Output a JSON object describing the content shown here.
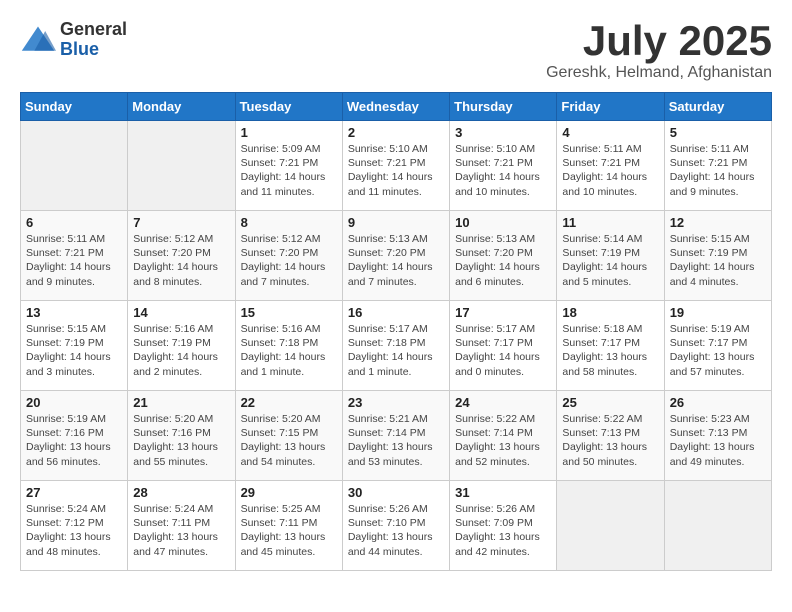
{
  "logo": {
    "general": "General",
    "blue": "Blue"
  },
  "title": "July 2025",
  "subtitle": "Gereshk, Helmand, Afghanistan",
  "days_header": [
    "Sunday",
    "Monday",
    "Tuesday",
    "Wednesday",
    "Thursday",
    "Friday",
    "Saturday"
  ],
  "weeks": [
    [
      {
        "day": "",
        "info": ""
      },
      {
        "day": "",
        "info": ""
      },
      {
        "day": "1",
        "info": "Sunrise: 5:09 AM\nSunset: 7:21 PM\nDaylight: 14 hours\nand 11 minutes."
      },
      {
        "day": "2",
        "info": "Sunrise: 5:10 AM\nSunset: 7:21 PM\nDaylight: 14 hours\nand 11 minutes."
      },
      {
        "day": "3",
        "info": "Sunrise: 5:10 AM\nSunset: 7:21 PM\nDaylight: 14 hours\nand 10 minutes."
      },
      {
        "day": "4",
        "info": "Sunrise: 5:11 AM\nSunset: 7:21 PM\nDaylight: 14 hours\nand 10 minutes."
      },
      {
        "day": "5",
        "info": "Sunrise: 5:11 AM\nSunset: 7:21 PM\nDaylight: 14 hours\nand 9 minutes."
      }
    ],
    [
      {
        "day": "6",
        "info": "Sunrise: 5:11 AM\nSunset: 7:21 PM\nDaylight: 14 hours\nand 9 minutes."
      },
      {
        "day": "7",
        "info": "Sunrise: 5:12 AM\nSunset: 7:20 PM\nDaylight: 14 hours\nand 8 minutes."
      },
      {
        "day": "8",
        "info": "Sunrise: 5:12 AM\nSunset: 7:20 PM\nDaylight: 14 hours\nand 7 minutes."
      },
      {
        "day": "9",
        "info": "Sunrise: 5:13 AM\nSunset: 7:20 PM\nDaylight: 14 hours\nand 7 minutes."
      },
      {
        "day": "10",
        "info": "Sunrise: 5:13 AM\nSunset: 7:20 PM\nDaylight: 14 hours\nand 6 minutes."
      },
      {
        "day": "11",
        "info": "Sunrise: 5:14 AM\nSunset: 7:19 PM\nDaylight: 14 hours\nand 5 minutes."
      },
      {
        "day": "12",
        "info": "Sunrise: 5:15 AM\nSunset: 7:19 PM\nDaylight: 14 hours\nand 4 minutes."
      }
    ],
    [
      {
        "day": "13",
        "info": "Sunrise: 5:15 AM\nSunset: 7:19 PM\nDaylight: 14 hours\nand 3 minutes."
      },
      {
        "day": "14",
        "info": "Sunrise: 5:16 AM\nSunset: 7:19 PM\nDaylight: 14 hours\nand 2 minutes."
      },
      {
        "day": "15",
        "info": "Sunrise: 5:16 AM\nSunset: 7:18 PM\nDaylight: 14 hours\nand 1 minute."
      },
      {
        "day": "16",
        "info": "Sunrise: 5:17 AM\nSunset: 7:18 PM\nDaylight: 14 hours\nand 1 minute."
      },
      {
        "day": "17",
        "info": "Sunrise: 5:17 AM\nSunset: 7:17 PM\nDaylight: 14 hours\nand 0 minutes."
      },
      {
        "day": "18",
        "info": "Sunrise: 5:18 AM\nSunset: 7:17 PM\nDaylight: 13 hours\nand 58 minutes."
      },
      {
        "day": "19",
        "info": "Sunrise: 5:19 AM\nSunset: 7:17 PM\nDaylight: 13 hours\nand 57 minutes."
      }
    ],
    [
      {
        "day": "20",
        "info": "Sunrise: 5:19 AM\nSunset: 7:16 PM\nDaylight: 13 hours\nand 56 minutes."
      },
      {
        "day": "21",
        "info": "Sunrise: 5:20 AM\nSunset: 7:16 PM\nDaylight: 13 hours\nand 55 minutes."
      },
      {
        "day": "22",
        "info": "Sunrise: 5:20 AM\nSunset: 7:15 PM\nDaylight: 13 hours\nand 54 minutes."
      },
      {
        "day": "23",
        "info": "Sunrise: 5:21 AM\nSunset: 7:14 PM\nDaylight: 13 hours\nand 53 minutes."
      },
      {
        "day": "24",
        "info": "Sunrise: 5:22 AM\nSunset: 7:14 PM\nDaylight: 13 hours\nand 52 minutes."
      },
      {
        "day": "25",
        "info": "Sunrise: 5:22 AM\nSunset: 7:13 PM\nDaylight: 13 hours\nand 50 minutes."
      },
      {
        "day": "26",
        "info": "Sunrise: 5:23 AM\nSunset: 7:13 PM\nDaylight: 13 hours\nand 49 minutes."
      }
    ],
    [
      {
        "day": "27",
        "info": "Sunrise: 5:24 AM\nSunset: 7:12 PM\nDaylight: 13 hours\nand 48 minutes."
      },
      {
        "day": "28",
        "info": "Sunrise: 5:24 AM\nSunset: 7:11 PM\nDaylight: 13 hours\nand 47 minutes."
      },
      {
        "day": "29",
        "info": "Sunrise: 5:25 AM\nSunset: 7:11 PM\nDaylight: 13 hours\nand 45 minutes."
      },
      {
        "day": "30",
        "info": "Sunrise: 5:26 AM\nSunset: 7:10 PM\nDaylight: 13 hours\nand 44 minutes."
      },
      {
        "day": "31",
        "info": "Sunrise: 5:26 AM\nSunset: 7:09 PM\nDaylight: 13 hours\nand 42 minutes."
      },
      {
        "day": "",
        "info": ""
      },
      {
        "day": "",
        "info": ""
      }
    ]
  ]
}
